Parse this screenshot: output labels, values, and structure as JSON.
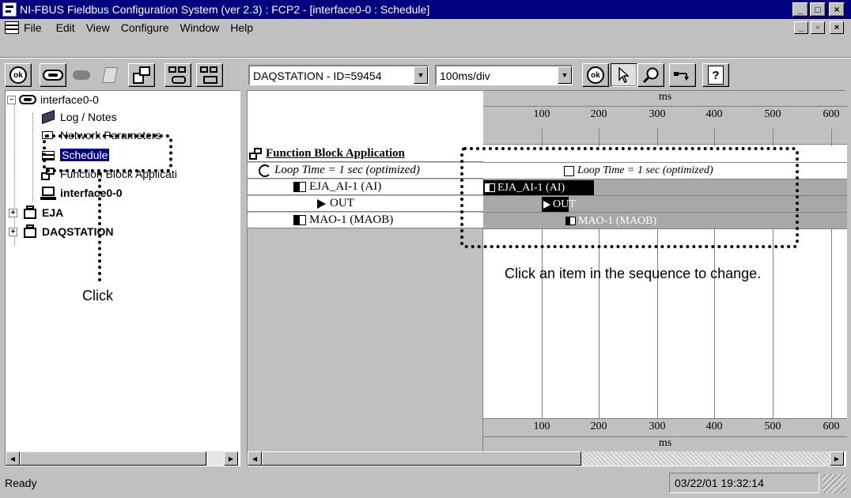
{
  "window": {
    "title": "NI-FBUS Fieldbus Configuration System (ver 2.3) : FCP2 - [interface0-0 : Schedule]",
    "controls": {
      "minimize": "_",
      "maximize": "□",
      "close": "×"
    }
  },
  "menu": {
    "items": [
      "File",
      "Edit",
      "View",
      "Configure",
      "Window",
      "Help"
    ],
    "mdi_controls": {
      "minimize": "_",
      "restore": "▫",
      "close": "×"
    }
  },
  "toolbar": {
    "device_combo": "DAQSTATION - ID=59454",
    "scale_combo": "100ms/div",
    "ok_label": "ok"
  },
  "tree": {
    "root": "interface0-0",
    "items": [
      {
        "label": "Log / Notes"
      },
      {
        "label": "Network Parameters"
      },
      {
        "label": "Schedule"
      },
      {
        "label": "Function Block Applicati"
      },
      {
        "label": "interface0-0"
      },
      {
        "label": "EJA"
      },
      {
        "label": "DAQSTATION"
      }
    ]
  },
  "schedule": {
    "list": {
      "header": "Function Block Application",
      "loop_time": "Loop Time = 1 sec (optimized)",
      "ai_block": "EJA_AI-1 (AI)",
      "out": "OUT",
      "mao_block": "MAO-1 (MAOB)"
    },
    "timeline": {
      "unit": "ms",
      "ticks": [
        "100",
        "200",
        "300",
        "400",
        "500",
        "600"
      ],
      "loop_time": "Loop Time = 1 sec (optimized)",
      "ai_block": "EJA_AI-1 (AI)",
      "out": "OUT",
      "mao_block": "MAO-1 (MAOB)"
    }
  },
  "annotations": {
    "click": "Click",
    "instruction": "Click an item in the sequence to change."
  },
  "status": {
    "text": "Ready",
    "datetime": "03/22/01 19:32:14"
  }
}
